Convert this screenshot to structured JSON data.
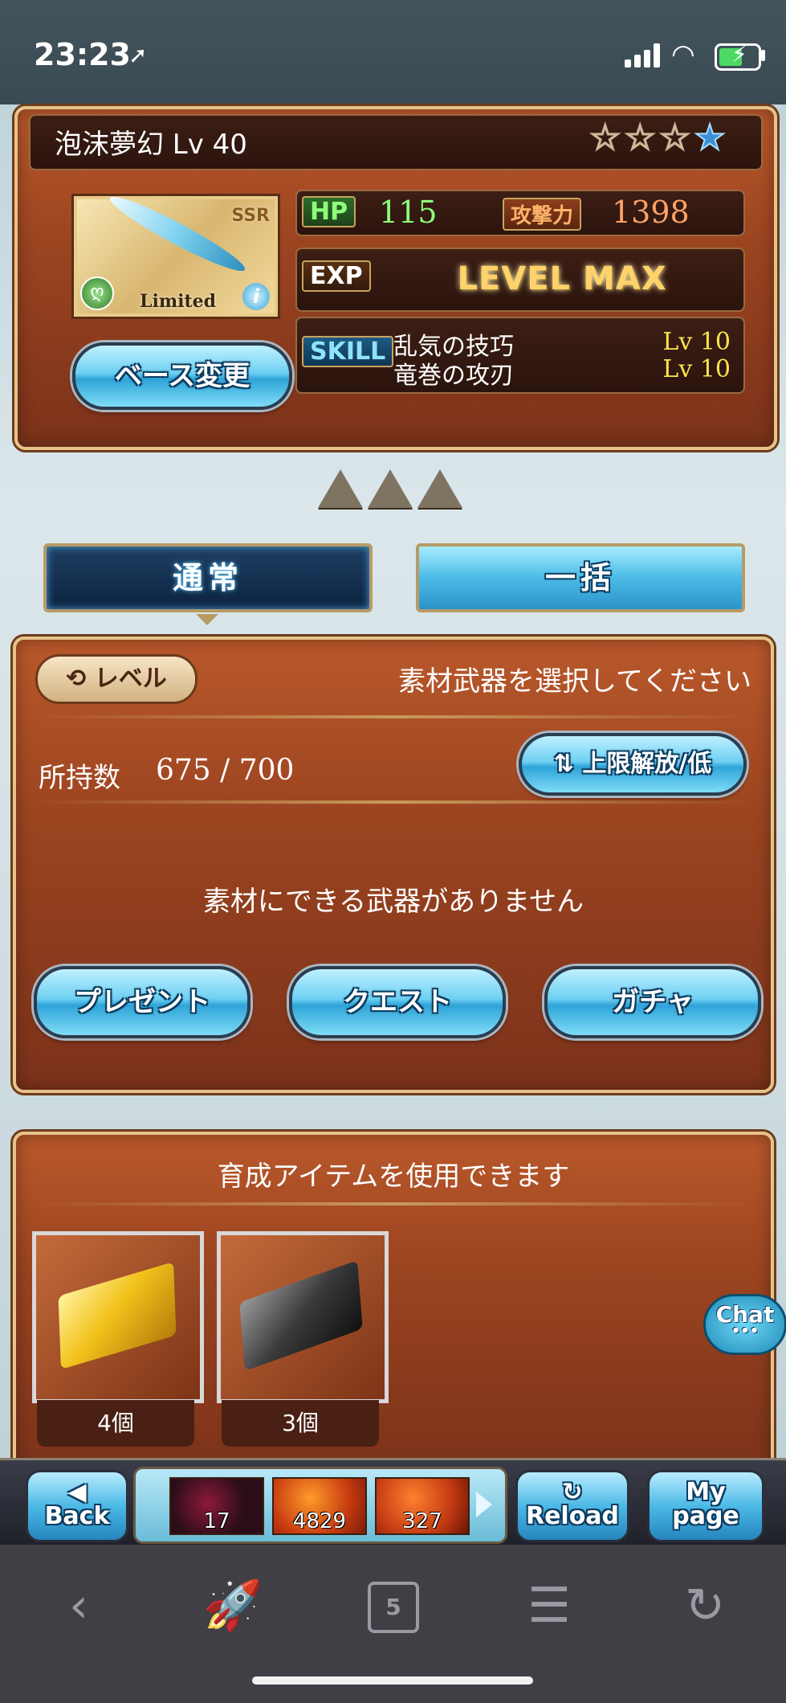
{
  "status_bar": {
    "time": "23:23",
    "location_icon": "location-arrow-icon"
  },
  "weapon": {
    "name": "泡沫夢幻 Lv 40",
    "rarity": "SSR",
    "limited_label": "Limited",
    "stars": [
      "☆",
      "☆",
      "☆",
      "★"
    ],
    "hp_label": "HP",
    "hp": "115",
    "atk_label": "攻撃力",
    "atk": "1398",
    "exp_label": "EXP",
    "exp_value": "LEVEL MAX",
    "skill_label": "SKILL",
    "skills": [
      {
        "name": "乱気の技巧",
        "level": "Lv 10"
      },
      {
        "name": "竜巻の攻刃",
        "level": "Lv 10"
      }
    ],
    "base_change_button": "ベース変更",
    "info_icon": "i"
  },
  "mode_tabs": {
    "normal": "通常",
    "bulk": "一括"
  },
  "material_panel": {
    "sort_button": "レベル",
    "title": "素材武器を選択してください",
    "owned_label": "所持数",
    "owned_value": "675 / 700",
    "limit_button": "上限解放/低",
    "empty_message": "素材にできる武器がありません",
    "sources": [
      "プレゼント",
      "クエスト",
      "ガチャ"
    ]
  },
  "item_panel": {
    "title": "育成アイテムを使用できます",
    "items": [
      {
        "icon": "gold-ingot-icon",
        "count": "4個"
      },
      {
        "icon": "dark-ingot-icon",
        "count": "3個"
      }
    ]
  },
  "chat_button": "Chat",
  "game_nav": {
    "back": "Back",
    "reload": "Reload",
    "mypage_line1": "My",
    "mypage_line2": "page",
    "resources": [
      {
        "icon": "crystal-orb-icon",
        "value": "17"
      },
      {
        "icon": "fire-item-icon",
        "value": "4829"
      },
      {
        "icon": "flame-item-icon",
        "value": "327"
      }
    ]
  },
  "browser": {
    "tab_count": "5"
  }
}
